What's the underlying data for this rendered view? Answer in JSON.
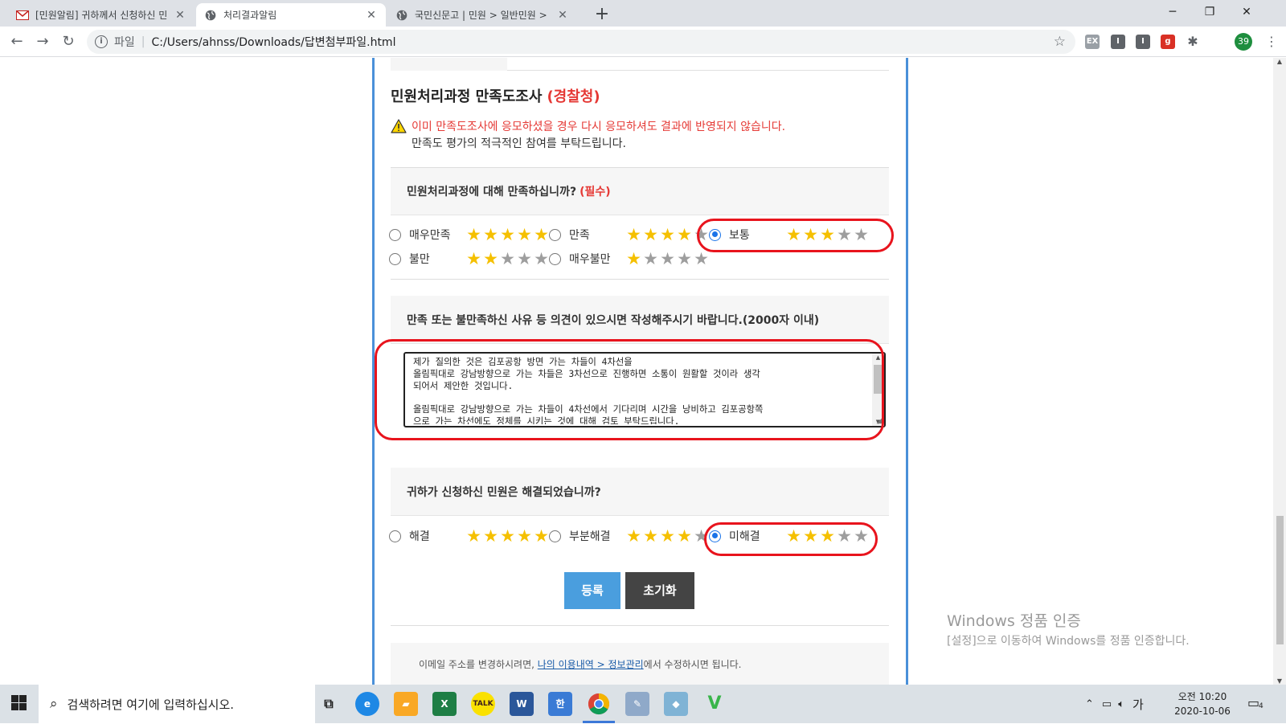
{
  "browser": {
    "tabs": [
      {
        "title": "[민원알림] 귀하께서 신청하신 민",
        "icon": "mail-icon"
      },
      {
        "title": "처리결과알림",
        "icon": "globe-icon"
      },
      {
        "title": "국민신문고 | 민원 > 일반민원 >",
        "icon": "globe-icon"
      }
    ],
    "address": {
      "scheme": "파일",
      "url": "C:/Users/ahnss/Downloads/답변첨부파일.html"
    },
    "profile_badge": "39"
  },
  "survey": {
    "title": "민원처리과정 만족도조사",
    "org": "(경찰청)",
    "warning_line1": "이미 만족도조사에 응모하셨을 경우 다시 응모하셔도 결과에 반영되지 않습니다.",
    "warning_line2": "만족도 평가의 적극적인 참여를 부탁드립니다.",
    "q1": {
      "question": "민원처리과정에 대해 만족하십니까?",
      "required": "(필수)",
      "options": [
        {
          "label": "매우만족",
          "stars": 5,
          "checked": false
        },
        {
          "label": "만족",
          "stars": 4,
          "checked": false
        },
        {
          "label": "보통",
          "stars": 3,
          "checked": true
        },
        {
          "label": "불만",
          "stars": 2,
          "checked": false
        },
        {
          "label": "매우불만",
          "stars": 1,
          "checked": false
        }
      ]
    },
    "q2": {
      "question": "만족 또는 불만족하신 사유 등 의견이 있으시면 작성해주시기 바랍니다.(2000자 이내)",
      "answer": "제가 질의한 것은 김포공항 방면 가는 차들이 4차선을\n올림픽대로 강남방향으로 가는 차들은 3차선으로 진행하면 소통이 원활할 것이라 생각\n되어서 제안한 것입니다.\n\n올림픽대로 강남방향으로 가는 차들이 4차선에서 기다리며 시간을 낭비하고 김포공항쪽\n으로 가는 차선에도 정체를 시키는 것에 대해 검토 부탁드립니다."
    },
    "q3": {
      "question": "귀하가 신청하신 민원은 해결되었습니까?",
      "options": [
        {
          "label": "해결",
          "stars": 5,
          "checked": false
        },
        {
          "label": "부분해결",
          "stars": 4,
          "checked": false
        },
        {
          "label": "미해결",
          "stars": 3,
          "checked": true
        }
      ]
    },
    "buttons": {
      "submit": "등록",
      "reset": "초기화"
    },
    "footer": {
      "prefix": "이메일 주소를 변경하시려면, ",
      "link": "나의 이용내역 > 정보관리",
      "suffix": "에서 수정하시면 됩니다."
    }
  },
  "watermark": {
    "line1": "Windows 정품 인증",
    "line2": "[설정]으로 이동하여 Windows를 정품 인증합니다."
  },
  "taskbar": {
    "search_placeholder": "검색하려면 여기에 입력하십시오.",
    "ime": "가",
    "time": "오전 10:20",
    "date": "2020-10-06",
    "notification_count": "4"
  },
  "colors": {
    "accent_red": "#e53935",
    "star_on": "#f5c000",
    "star_off": "#9e9e9e",
    "submit_blue": "#4a9ede",
    "frame_blue": "#4a90d9"
  }
}
